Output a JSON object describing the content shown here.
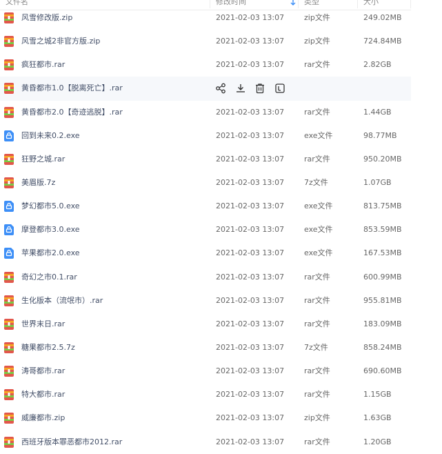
{
  "header": {
    "name_col": "文件名",
    "date_col": "修改时间",
    "type_col": "类型",
    "size_col": "大小"
  },
  "colors": {
    "archive_icon": "#e2574c",
    "archive_stripe": "#f5a623",
    "exe_icon": "#3d8ff7",
    "name_text": "#424e67",
    "hover_row": "#f6f8fb",
    "sort_arrow": "#3d8ff7"
  },
  "files": [
    {
      "name": "风雪修改版.zip",
      "date": "2021-02-03 13:07",
      "type": "zip文件",
      "size": "249.02MB",
      "icon": "archive-icon"
    },
    {
      "name": "风雪之城2非官方版.zip",
      "date": "2021-02-03 13:07",
      "type": "zip文件",
      "size": "724.84MB",
      "icon": "archive-icon"
    },
    {
      "name": "疯狂都市.rar",
      "date": "2021-02-03 13:07",
      "type": "rar文件",
      "size": "2.82GB",
      "icon": "archive-icon"
    },
    {
      "name": "黄昏都市1.0【脱离死亡】.rar",
      "date": "",
      "type": "",
      "size": "",
      "icon": "archive-icon",
      "hover": true
    },
    {
      "name": "黄昏都市2.0【奇迹逃脱】.rar",
      "date": "2021-02-03 13:07",
      "type": "rar文件",
      "size": "1.44GB",
      "icon": "archive-icon"
    },
    {
      "name": "回到未来0.2.exe",
      "date": "2021-02-03 13:07",
      "type": "exe文件",
      "size": "98.77MB",
      "icon": "exe-icon"
    },
    {
      "name": "狂野之城.rar",
      "date": "2021-02-03 13:07",
      "type": "rar文件",
      "size": "950.20MB",
      "icon": "archive-icon"
    },
    {
      "name": "美眉版.7z",
      "date": "2021-02-03 13:07",
      "type": "7z文件",
      "size": "1.07GB",
      "icon": "archive-icon"
    },
    {
      "name": "梦幻都市5.0.exe",
      "date": "2021-02-03 13:07",
      "type": "exe文件",
      "size": "813.75MB",
      "icon": "exe-icon"
    },
    {
      "name": "摩登都市3.0.exe",
      "date": "2021-02-03 13:07",
      "type": "exe文件",
      "size": "853.59MB",
      "icon": "exe-icon"
    },
    {
      "name": "苹果都市2.0.exe",
      "date": "2021-02-03 13:07",
      "type": "exe文件",
      "size": "167.53MB",
      "icon": "exe-icon"
    },
    {
      "name": "奇幻之市0.1.rar",
      "date": "2021-02-03 13:07",
      "type": "rar文件",
      "size": "600.99MB",
      "icon": "archive-icon"
    },
    {
      "name": "生化版本（流氓市）.rar",
      "date": "2021-02-03 13:07",
      "type": "rar文件",
      "size": "955.81MB",
      "icon": "archive-icon"
    },
    {
      "name": "世界末日.rar",
      "date": "2021-02-03 13:07",
      "type": "rar文件",
      "size": "183.09MB",
      "icon": "archive-icon"
    },
    {
      "name": "糖果都市2.5.7z",
      "date": "2021-02-03 13:07",
      "type": "7z文件",
      "size": "858.24MB",
      "icon": "archive-icon"
    },
    {
      "name": "涛哥都市.rar",
      "date": "2021-02-03 13:07",
      "type": "rar文件",
      "size": "690.60MB",
      "icon": "archive-icon"
    },
    {
      "name": "特大都市.rar",
      "date": "2021-02-03 13:07",
      "type": "rar文件",
      "size": "1.15GB",
      "icon": "archive-icon"
    },
    {
      "name": "威廉都市.zip",
      "date": "2021-02-03 13:07",
      "type": "zip文件",
      "size": "1.63GB",
      "icon": "archive-icon"
    },
    {
      "name": "西班牙版本罪恶都市2012.rar",
      "date": "2021-02-03 13:07",
      "type": "rar文件",
      "size": "1.20GB",
      "icon": "archive-icon"
    }
  ],
  "hover_actions": [
    "share-icon",
    "download-icon",
    "delete-icon",
    "more-icon"
  ]
}
